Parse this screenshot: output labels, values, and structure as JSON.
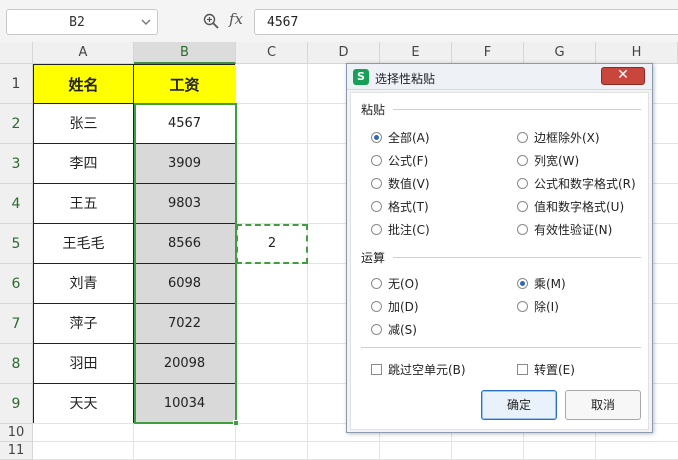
{
  "formula_bar": {
    "name_box": "B2",
    "fx_label": "fx",
    "formula_value": "4567"
  },
  "columns": [
    "A",
    "B",
    "C",
    "D",
    "E",
    "F",
    "G",
    "H"
  ],
  "rows": [
    "1",
    "2",
    "3",
    "4",
    "5",
    "6",
    "7",
    "8",
    "9",
    "10",
    "11"
  ],
  "table": {
    "header_name": "姓名",
    "header_salary": "工资",
    "names": [
      "张三",
      "李四",
      "王五",
      "王毛毛",
      "刘青",
      "萍子",
      "羽田",
      "天天"
    ],
    "salaries": [
      "4567",
      "3909",
      "9803",
      "8566",
      "6098",
      "7022",
      "20098",
      "10034"
    ]
  },
  "copied_cell": {
    "ref": "C5",
    "value": "2"
  },
  "dialog": {
    "title": "选择性粘贴",
    "close_glyph": "✕",
    "logo_letter": "S",
    "paste_group": "粘贴",
    "paste_options": [
      {
        "label": "全部(A)",
        "selected": true
      },
      {
        "label": "公式(F)",
        "selected": false
      },
      {
        "label": "数值(V)",
        "selected": false
      },
      {
        "label": "格式(T)",
        "selected": false
      },
      {
        "label": "批注(C)",
        "selected": false
      },
      {
        "label": "边框除外(X)",
        "selected": false
      },
      {
        "label": "列宽(W)",
        "selected": false
      },
      {
        "label": "公式和数字格式(R)",
        "selected": false
      },
      {
        "label": "值和数字格式(U)",
        "selected": false
      },
      {
        "label": "有效性验证(N)",
        "selected": false
      }
    ],
    "operation_group": "运算",
    "operation_options": [
      {
        "label": "无(O)",
        "selected": false
      },
      {
        "label": "加(D)",
        "selected": false
      },
      {
        "label": "减(S)",
        "selected": false
      },
      {
        "label": "乘(M)",
        "selected": true
      },
      {
        "label": "除(I)",
        "selected": false
      }
    ],
    "skip_blanks": {
      "label": "跳过空单元(B)",
      "checked": false
    },
    "transpose": {
      "label": "转置(E)",
      "checked": false
    },
    "ok_label": "确定",
    "cancel_label": "取消"
  },
  "colors": {
    "selection": "#3f9f3f",
    "header_fill": "#ffff00",
    "number_fill": "#d9d9d9",
    "close_button": "#c9463d",
    "radio_dot": "#3067b8"
  }
}
